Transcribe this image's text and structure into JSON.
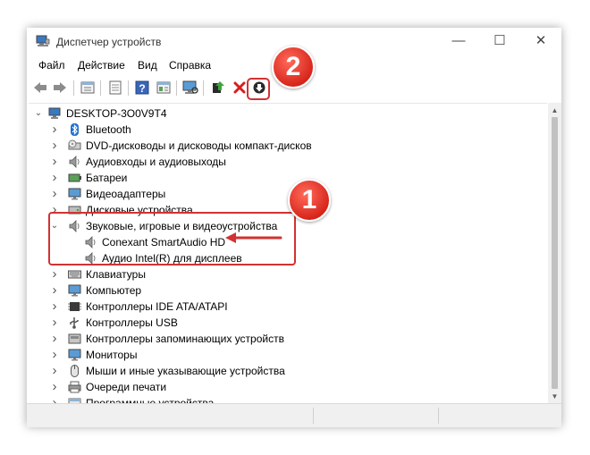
{
  "window": {
    "title": "Диспетчер устройств",
    "minimize": "—",
    "maximize": "☐",
    "close": "✕"
  },
  "menu": [
    "Файл",
    "Действие",
    "Вид",
    "Справка"
  ],
  "tree": {
    "root": "DESKTOP-3O0V9T4",
    "items": [
      "Bluetooth",
      "DVD-дисководы и дисководы компакт-дисков",
      "Аудиовходы и аудиовыходы",
      "Батареи",
      "Видеоадаптеры",
      "Дисковые устройства",
      "Звуковые, игровые и видеоустройства",
      "Conexant SmartAudio HD",
      "Аудио Intel(R) для дисплеев",
      "Клавиатуры",
      "Компьютер",
      "Контроллеры IDE ATA/ATAPI",
      "Контроллеры USB",
      "Контроллеры запоминающих устройств",
      "Мониторы",
      "Мыши и иные указывающие устройства",
      "Очереди печати",
      "Программные устройства"
    ]
  },
  "annotations": {
    "badge_1": "1",
    "badge_2": "2"
  },
  "colors": {
    "annotation_red": "#d23232",
    "bluetooth_blue": "#1f6fd1",
    "uninstall_red": "#d81e1e"
  }
}
